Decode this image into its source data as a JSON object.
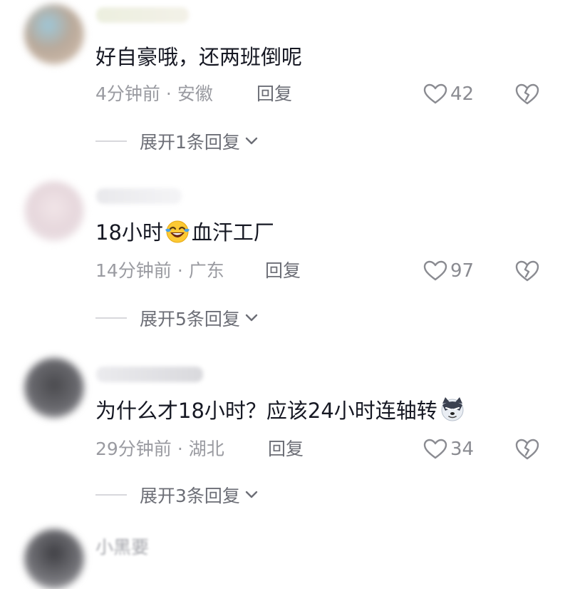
{
  "comments": [
    {
      "text": "好自豪哦，还两班倒呢",
      "time": "4分钟前",
      "location": "安徽",
      "reply_label": "回复",
      "likes": "42",
      "expand_label": "展开1条回复"
    },
    {
      "text_before": "18小时",
      "emoji": "crying-laughing-emoji",
      "text_after": "血汗工厂",
      "time": "14分钟前",
      "location": "广东",
      "reply_label": "回复",
      "likes": "97",
      "expand_label": "展开5条回复"
    },
    {
      "text": "为什么才18小时？应该24小时连轴转",
      "emoji": "husky-dog-emoji",
      "time": "29分钟前",
      "location": "湖北",
      "reply_label": "回复",
      "likes": "34",
      "expand_label": "展开3条回复"
    }
  ],
  "partial_next_username": "小黑要",
  "colors": {
    "primary_text": "#161823",
    "meta_text": "#9a9ba1",
    "reply_text": "#6c6e76",
    "icon": "#8a8b91"
  }
}
